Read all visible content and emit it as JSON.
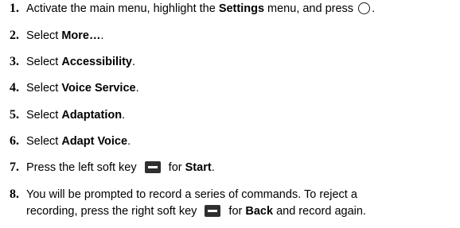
{
  "steps": [
    {
      "num": "1.",
      "pre": "Activate the main menu, highlight the ",
      "bold": "Settings",
      "post": " menu, and press ",
      "icon": "circle-key-icon",
      "end": "."
    },
    {
      "num": "2.",
      "pre": "Select ",
      "bold": "More…",
      "post": "."
    },
    {
      "num": "3.",
      "pre": "Select ",
      "bold": "Accessibility",
      "post": "."
    },
    {
      "num": "4.",
      "pre": "Select ",
      "bold": "Voice Service",
      "post": "."
    },
    {
      "num": "5.",
      "pre": "Select ",
      "bold": "Adaptation",
      "post": "."
    },
    {
      "num": "6.",
      "pre": "Select ",
      "bold": "Adapt Voice",
      "post": "."
    },
    {
      "num": "7.",
      "pre": "Press the left soft key ",
      "icon": "left-soft-key-icon",
      "mid": " for ",
      "bold": "Start",
      "post": "."
    },
    {
      "num": "8.",
      "line1": "You will be prompted to record a series of commands. To reject a",
      "pre": "recording, press the right soft key ",
      "icon": "right-soft-key-icon",
      "mid": " for ",
      "bold": "Back",
      "post": " and record again."
    }
  ]
}
